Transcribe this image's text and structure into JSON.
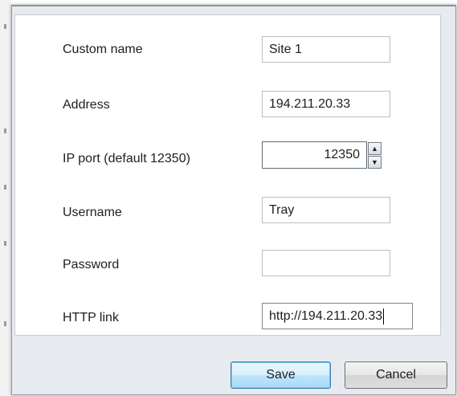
{
  "form": {
    "custom_name": {
      "label": "Custom name",
      "value": "Site 1"
    },
    "address": {
      "label": "Address",
      "value": "194.211.20.33"
    },
    "ip_port": {
      "label": "IP port (default 12350)",
      "value": "12350",
      "spin_up": "▲",
      "spin_down": "▼"
    },
    "username": {
      "label": "Username",
      "value": "Tray"
    },
    "password": {
      "label": "Password",
      "value": ""
    },
    "http_link": {
      "label": "HTTP link",
      "value": "http://194.211.20.33"
    }
  },
  "buttons": {
    "save": "Save",
    "cancel": "Cancel"
  },
  "colors": {
    "dialog_background": "#e7ebef",
    "panel_background": "#ffffff",
    "default_button_accent": "#3c7fb1"
  }
}
